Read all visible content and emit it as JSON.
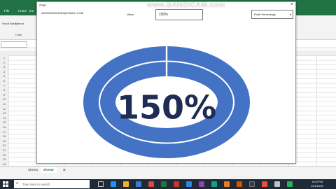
{
  "excel": {
    "tabs": [
      "File",
      "Home",
      "Ins"
    ],
    "ribbon": {
      "btn1": "Visual Basic",
      "btn2": "Macros",
      "group": "Code"
    },
    "rows": [
      "1",
      "2",
      "3",
      "4",
      "5",
      "6",
      "7",
      "8",
      "9",
      "10",
      "11",
      "12",
      "13",
      "14",
      "15",
      "16",
      "17",
      "18",
      "19",
      "20",
      "21",
      "22",
      "23",
      "24"
    ],
    "sheets": [
      "Sheet1",
      "Sheet2"
    ]
  },
  "dialog": {
    "title": "chart",
    "email": "ZAHIDSIDDIKAR@GMAIL.COM",
    "value_label": "Value",
    "value": "150%",
    "select_value": "Profit Percentage"
  },
  "gauge": {
    "value_text": "150%",
    "fill_fraction": 1.5,
    "color": "#4472c4"
  },
  "watermark": "www.BANDICAM.com",
  "taskbar": {
    "search_placeholder": "Type here to search",
    "time": "5:04 PM",
    "date": "12/1/2020"
  }
}
